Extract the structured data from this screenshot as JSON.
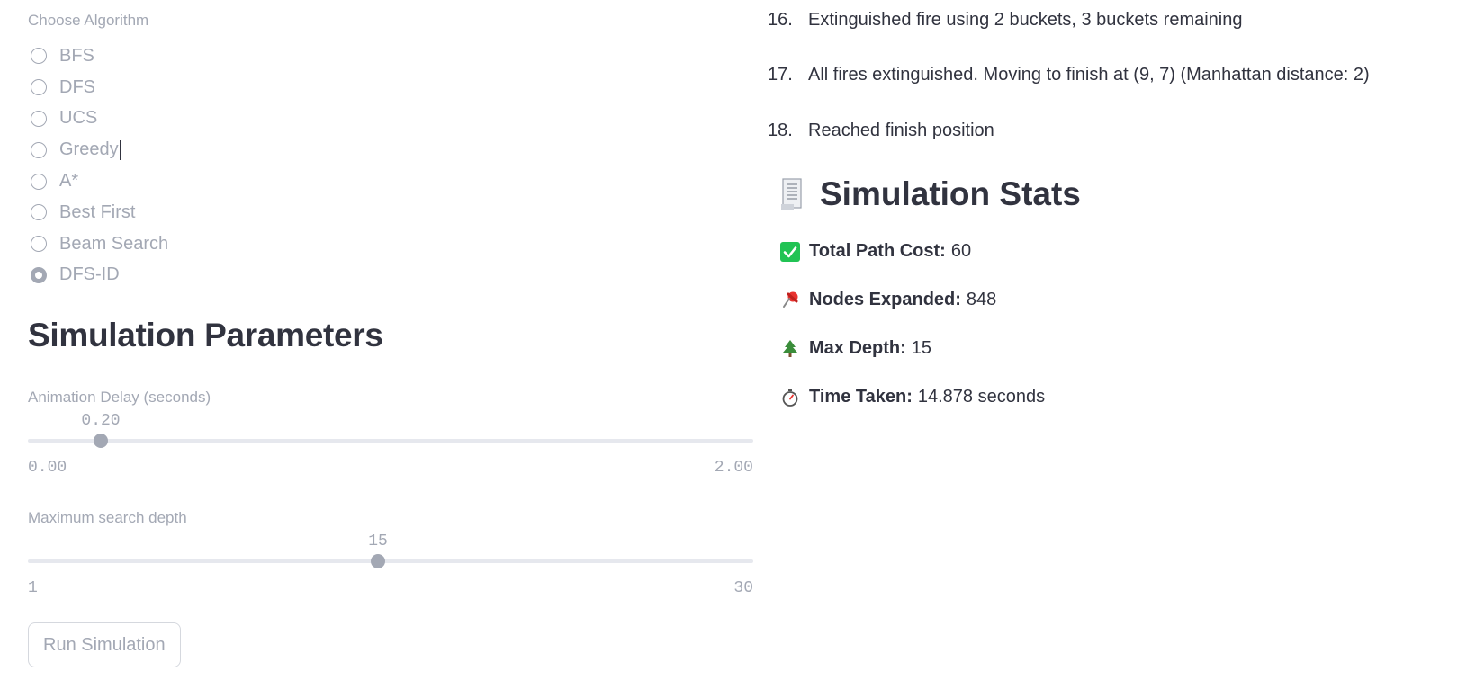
{
  "algorithm": {
    "label": "Choose Algorithm",
    "options": [
      "BFS",
      "DFS",
      "UCS",
      "Greedy",
      "A*",
      "Best First",
      "Beam Search",
      "DFS-ID"
    ],
    "selected": "DFS-ID"
  },
  "params": {
    "heading": "Simulation Parameters",
    "delay": {
      "label": "Animation Delay (seconds)",
      "value": "0.20",
      "min": "0.00",
      "max": "2.00",
      "fraction": 0.1
    },
    "depth": {
      "label": "Maximum search depth",
      "value": "15",
      "min": "1",
      "max": "30",
      "fraction": 0.4828
    },
    "run_label": "Run Simulation"
  },
  "log": [
    {
      "num": "16.",
      "text": "Extinguished fire using 2 buckets, 3 buckets remaining"
    },
    {
      "num": "17.",
      "text": "All fires extinguished. Moving to finish at (9, 7) (Manhattan distance: 2)"
    },
    {
      "num": "18.",
      "text": "Reached finish position"
    }
  ],
  "stats": {
    "heading": "Simulation Stats",
    "icon": "receipt-icon",
    "rows": [
      {
        "icon": "check-box-icon",
        "key": "Total Path Cost:",
        "value": "60"
      },
      {
        "icon": "pushpin-icon",
        "key": "Nodes Expanded:",
        "value": "848"
      },
      {
        "icon": "tree-icon",
        "key": "Max Depth:",
        "value": "15"
      },
      {
        "icon": "stopwatch-icon",
        "key": "Time Taken:",
        "value": "14.878 seconds"
      }
    ]
  },
  "colors": {
    "accent": "#a3a8b4",
    "text": "#31333f",
    "check": "#21c354"
  }
}
